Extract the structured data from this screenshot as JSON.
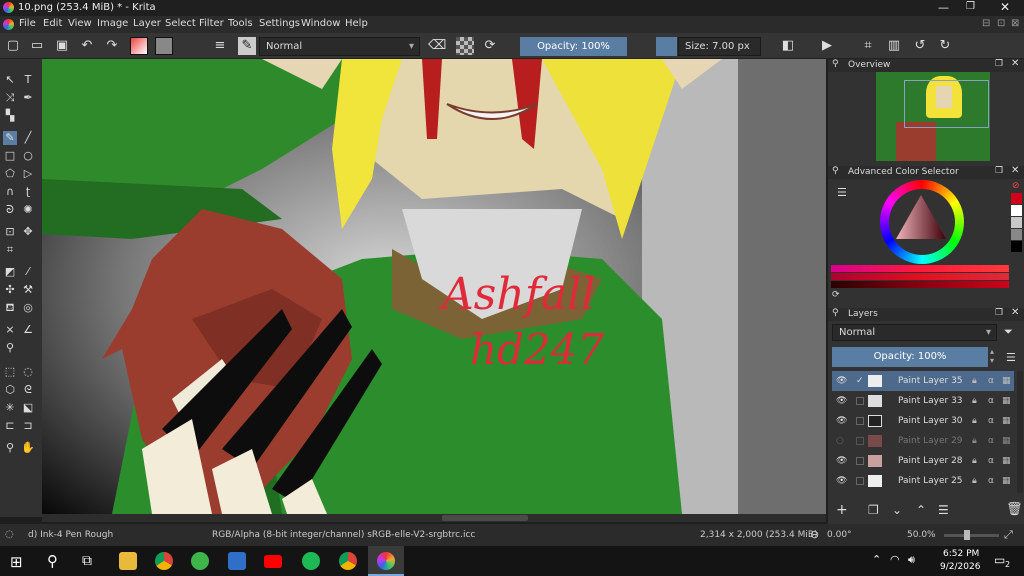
{
  "window": {
    "title": "10.png (253.4 MiB) * - Krita"
  },
  "menu": [
    "File",
    "Edit",
    "View",
    "Image",
    "Layer",
    "Select",
    "Filter",
    "Tools",
    "Settings",
    "Window",
    "Help"
  ],
  "toolbar": {
    "blend_mode": "Normal",
    "opacity": "Opacity: 100%",
    "size": "Size: 7.00 px"
  },
  "canvas_text": {
    "line1": "Ashfall",
    "line2": "hd247"
  },
  "panels": {
    "overview": "Overview",
    "color_selector": "Advanced Color Selector",
    "layers": "Layers",
    "layer_blend": "Normal",
    "layer_opacity": "Opacity: 100%"
  },
  "layers": [
    {
      "name": "Paint Layer 35",
      "visible": true,
      "active": true
    },
    {
      "name": "Paint Layer 33",
      "visible": true,
      "active": false
    },
    {
      "name": "Paint Layer 30",
      "visible": true,
      "active": false
    },
    {
      "name": "Paint Layer 29",
      "visible": false,
      "active": false
    },
    {
      "name": "Paint Layer 28",
      "visible": true,
      "active": false
    },
    {
      "name": "Paint Layer 25",
      "visible": true,
      "active": false
    }
  ],
  "status": {
    "brush": "d) Ink-4 Pen Rough",
    "colorspace": "RGB/Alpha (8-bit integer/channel)  sRGB-elle-V2-srgbtrc.icc",
    "dims": "2,314 x 2,000 (253.4 MiB)",
    "rotation": "0.00°",
    "zoom": "50.0%"
  },
  "taskbar": {
    "time": "6:52 PM",
    "date": "9/2/2026",
    "notif": "2"
  },
  "colors": {
    "accent": "#5a7ea3",
    "fg": "#d0021b",
    "bg": "#ffffff"
  }
}
